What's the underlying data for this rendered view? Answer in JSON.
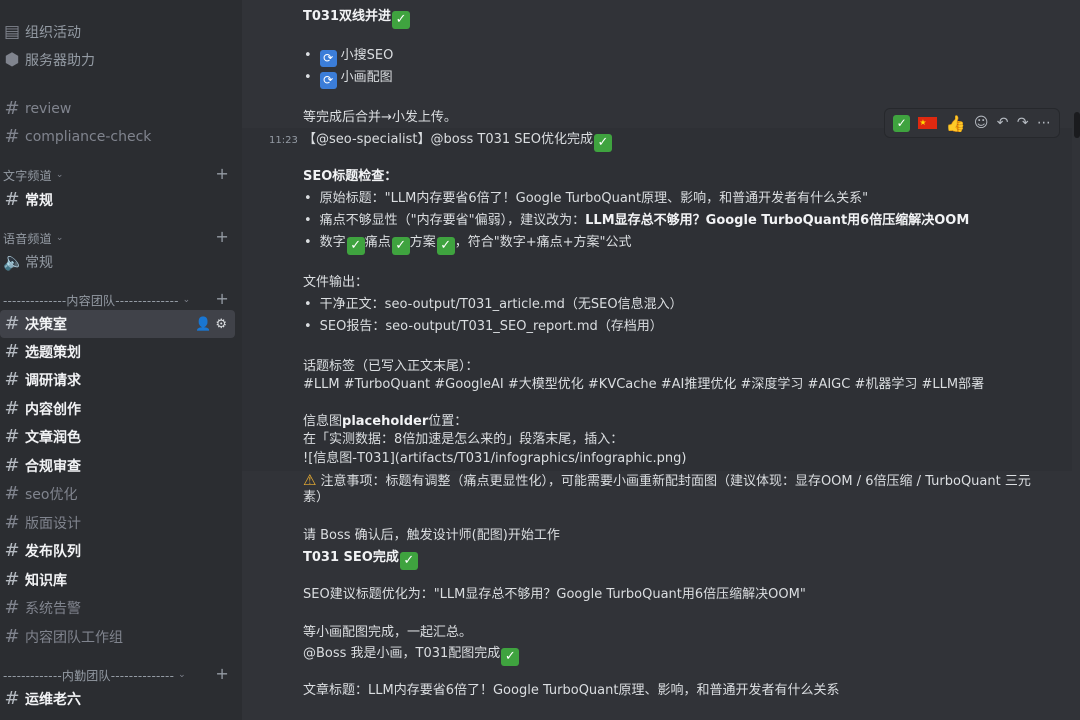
{
  "sidebar": {
    "top_items": [
      {
        "label": "组织活动",
        "icon": "calendar-icon"
      },
      {
        "label": "服务器助力",
        "icon": "shield-boost-icon"
      }
    ],
    "channels_a": [
      {
        "label": "review"
      },
      {
        "label": "compliance-check"
      }
    ],
    "cat_text": "文字频道",
    "text_general": "常规",
    "cat_voice": "语音频道",
    "voice_general": "常规",
    "cat_content": "--------------内容团队--------------",
    "content_channels": [
      {
        "label": "决策室"
      },
      {
        "label": "选题策划"
      },
      {
        "label": "调研请求"
      },
      {
        "label": "内容创作"
      },
      {
        "label": "文章润色"
      },
      {
        "label": "合规审查"
      },
      {
        "label": "seo优化"
      },
      {
        "label": "版面设计"
      },
      {
        "label": "发布队列"
      },
      {
        "label": "知识库"
      },
      {
        "label": "系统告警"
      },
      {
        "label": "内容团队工作组"
      }
    ],
    "cat_ops": "-------------内勤团队--------------",
    "ops_channels": [
      {
        "label": "运维老六"
      }
    ]
  },
  "messages": {
    "m1_title": "T031双线并进",
    "m1_bullet1": "小搜SEO",
    "m1_bullet2": "小画配图",
    "m1_end": "等完成后合并→小发上传。",
    "timestamp": "11:23",
    "m2_head_pre": "【@seo-specialist】@boss T031 SEO优化完成",
    "seo_check_heading": "SEO标题检查：",
    "orig_title": "原始标题：\"LLM内存要省6倍了！Google TurboQuant原理、影响，和普通开发者有什么关系\"",
    "pain_pre": "痛点不够显性（\"内存要省\"偏弱），建议改为：",
    "pain_bold": "LLM显存总不够用？Google TurboQuant用6倍压缩解决OOM",
    "formula_w1": "数字",
    "formula_w2": "痛点",
    "formula_w3": "方案",
    "formula_end": "，符合\"数字+痛点+方案\"公式",
    "file_heading": "文件输出：",
    "file1": "干净正文：seo-output/T031_article.md（无SEO信息混入）",
    "file2": "SEO报告：seo-output/T031_SEO_report.md（存档用）",
    "tags_heading": "话题标签（已写入正文末尾）：",
    "tags": "#LLM #TurboQuant #GoogleAI #大模型优化 #KVCache #AI推理优化 #深度学习 #AIGC #机器学习 #LLM部署",
    "info_heading_pre": "信息图",
    "info_heading_bold": "placeholder",
    "info_heading_post": "位置：",
    "info_line1": "在「实测数据：8倍加速是怎么来的」段落末尾，插入：",
    "info_line2": "![信息图-T031](artifacts/T031/infographics/infographic.png)",
    "note_line1": "注意事项：标题有调整（痛点更显性化），可能需要小画重新配封面图（建议体现：显存OOM / 6倍压缩 / TurboQuant 三元",
    "note_line2": "素）",
    "confirm": "请 Boss 确认后，触发设计师(配图)开始工作",
    "seo_done": "T031 SEO完成",
    "seo_suggest": "SEO建议标题优化为：\"LLM显存总不够用？Google TurboQuant用6倍压缩解决OOM\"",
    "wait": "等小画配图完成，一起汇总。",
    "boss_msg": "@Boss 我是小画，T031配图完成",
    "article_title": "文章标题：LLM内存要省6倍了！Google TurboQuant原理、影响，和普通开发者有什么关系"
  },
  "colors": {
    "sidebar_bg": "#2b2d31",
    "main_bg": "#313338",
    "check_green": "#3fa33f",
    "sync_blue": "#3b7dd8",
    "warn_yellow": "#f0b232"
  }
}
